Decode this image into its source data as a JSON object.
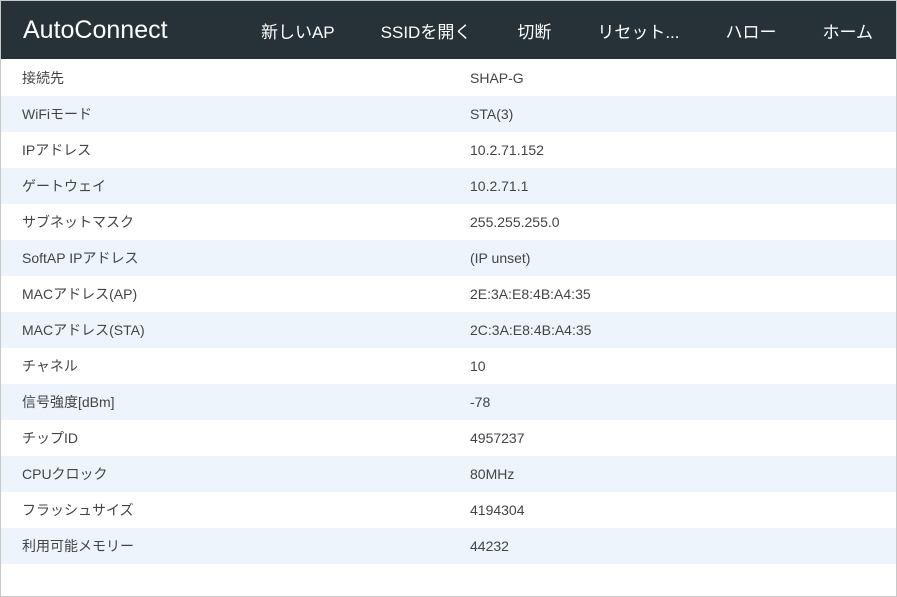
{
  "header": {
    "brand": "AutoConnect",
    "nav": [
      {
        "label": "新しいAP"
      },
      {
        "label": "SSIDを開く"
      },
      {
        "label": "切断"
      },
      {
        "label": "リセット..."
      },
      {
        "label": "ハロー"
      },
      {
        "label": "ホーム"
      }
    ]
  },
  "colors": {
    "header_bg": "#263238",
    "stripe_bg": "#eef4fc",
    "text": "#444444"
  },
  "rows": [
    {
      "key": "接続先",
      "value": "SHAP-G"
    },
    {
      "key": "WiFiモード",
      "value": "STA(3)"
    },
    {
      "key": "IPアドレス",
      "value": "10.2.71.152"
    },
    {
      "key": "ゲートウェイ",
      "value": "10.2.71.1"
    },
    {
      "key": "サブネットマスク",
      "value": "255.255.255.0"
    },
    {
      "key": "SoftAP IPアドレス",
      "value": "(IP unset)"
    },
    {
      "key": "MACアドレス(AP)",
      "value": "2E:3A:E8:4B:A4:35"
    },
    {
      "key": "MACアドレス(STA)",
      "value": "2C:3A:E8:4B:A4:35"
    },
    {
      "key": "チャネル",
      "value": "10"
    },
    {
      "key": "信号強度[dBm]",
      "value": "-78"
    },
    {
      "key": "チップID",
      "value": "4957237"
    },
    {
      "key": "CPUクロック",
      "value": "80MHz"
    },
    {
      "key": "フラッシュサイズ",
      "value": "4194304"
    },
    {
      "key": "利用可能メモリー",
      "value": "44232"
    }
  ]
}
